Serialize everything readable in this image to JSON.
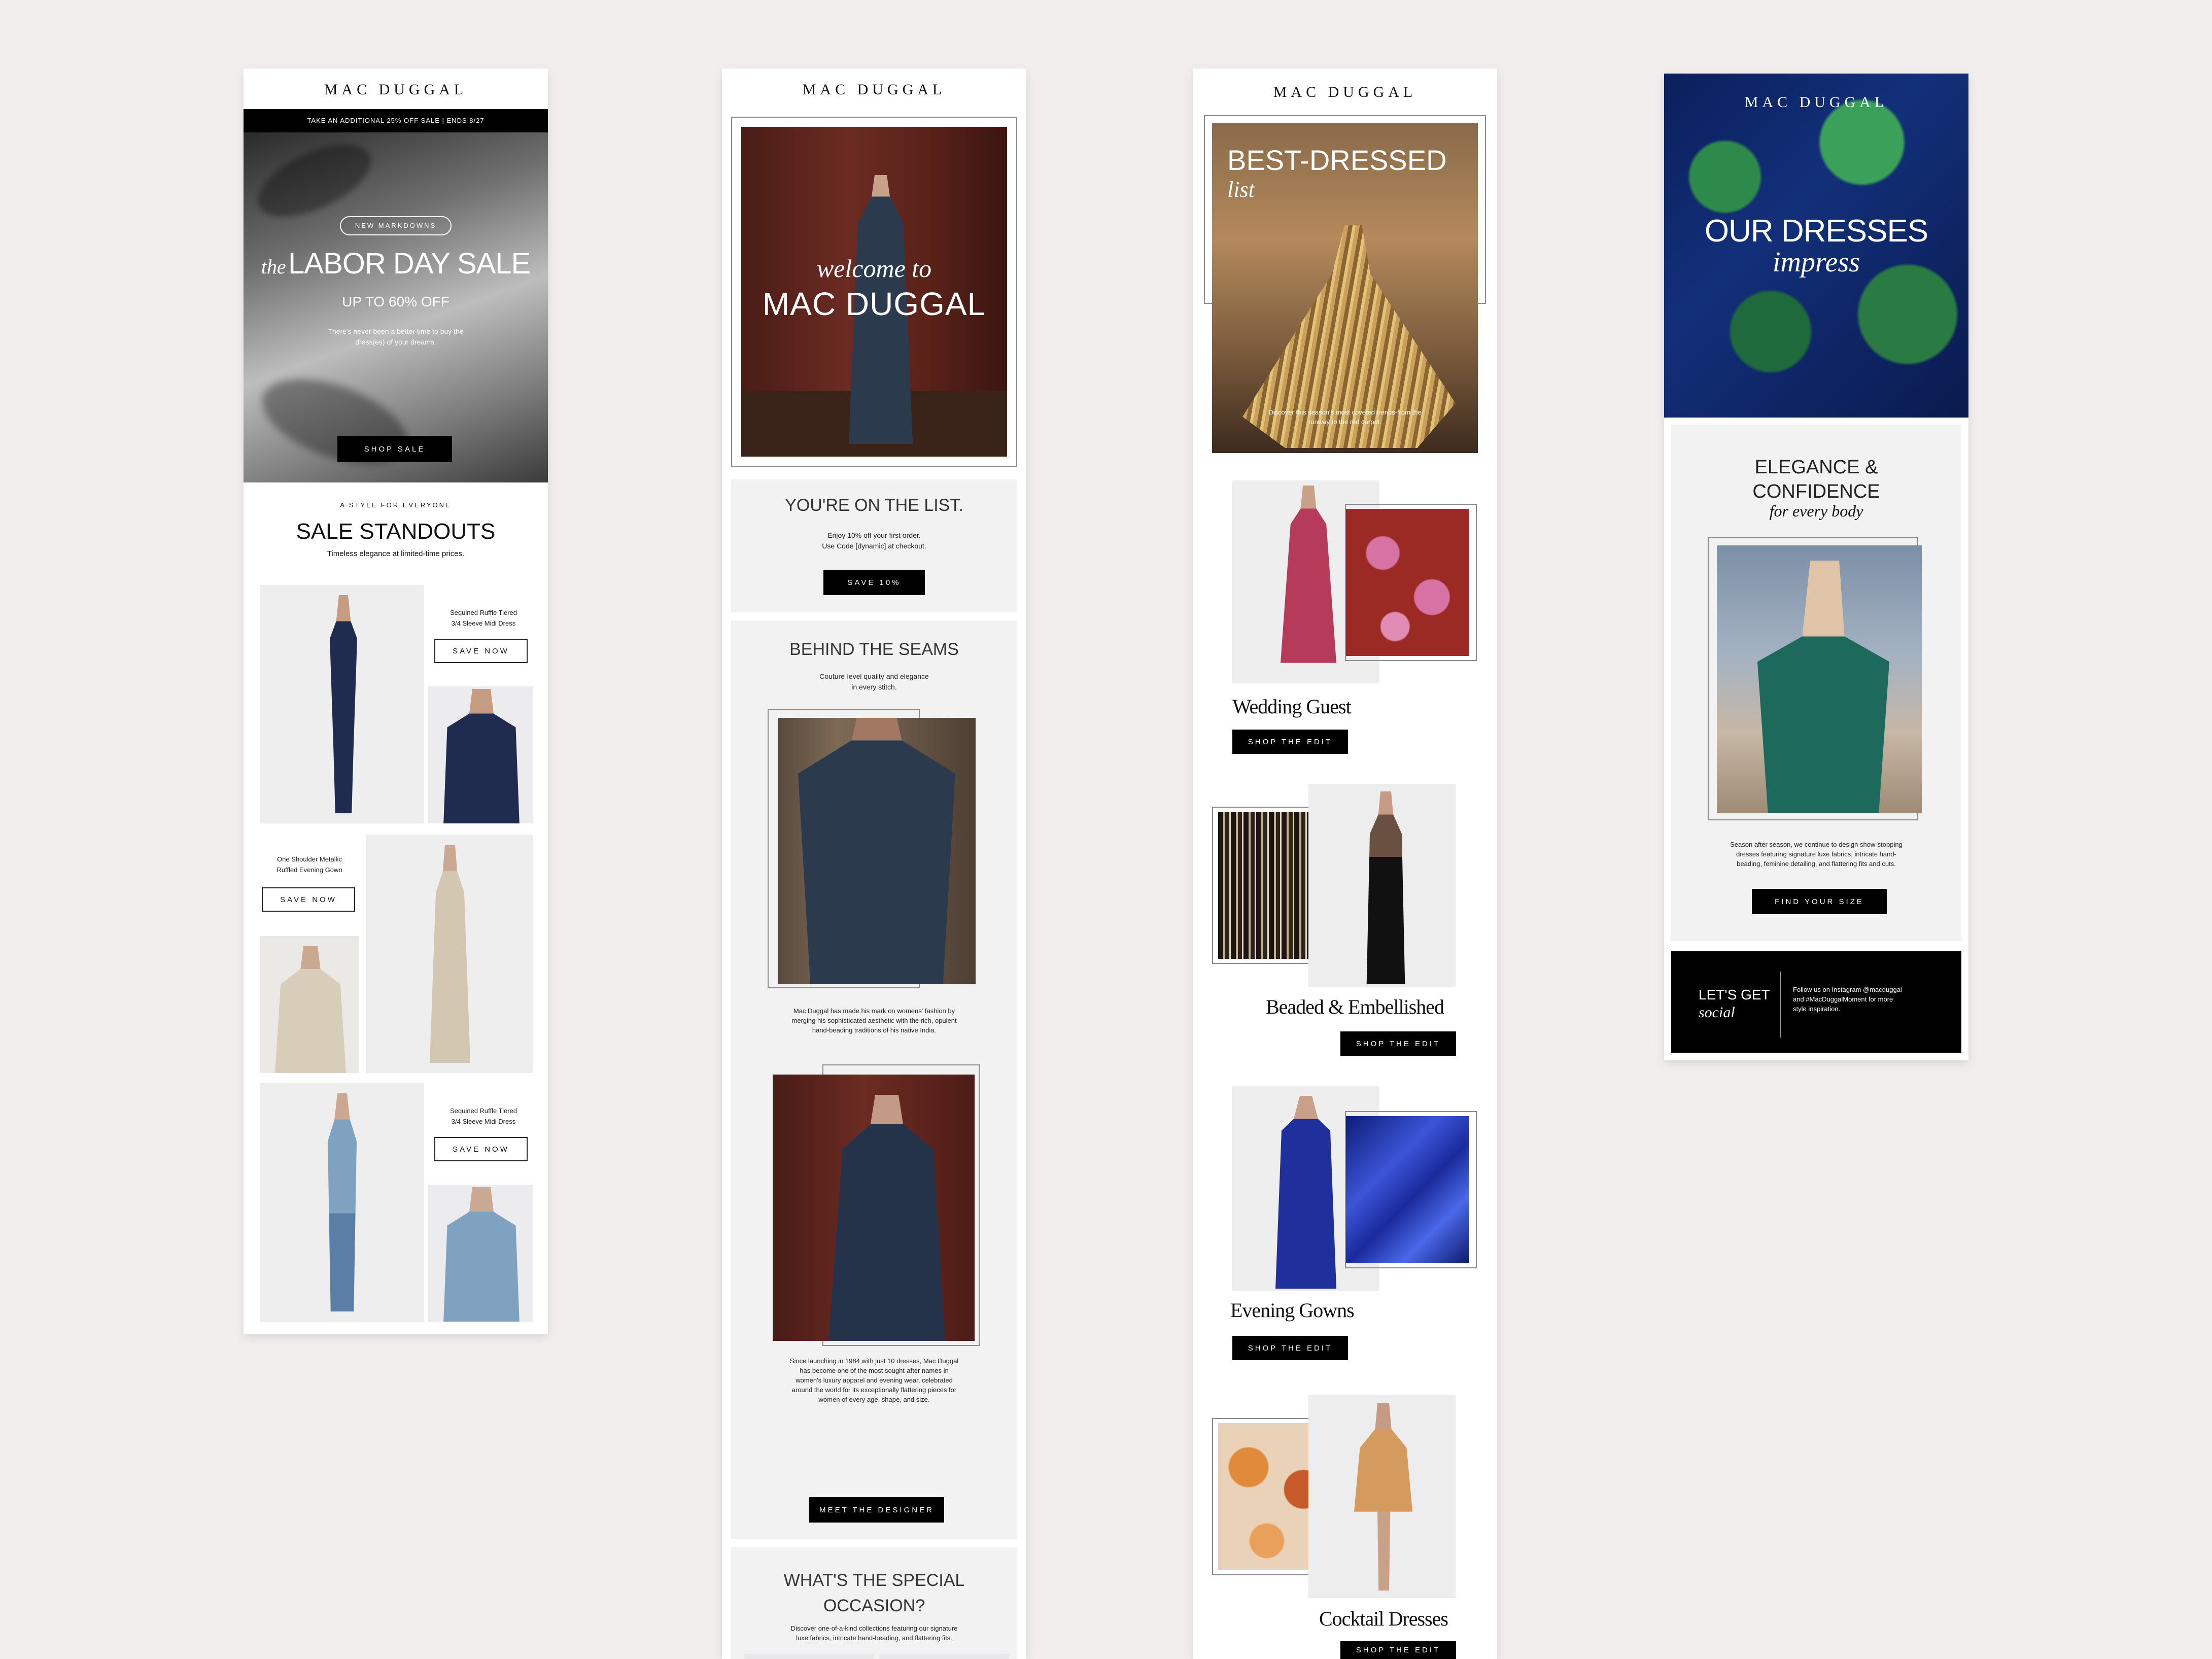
{
  "email1": {
    "brand": "MAC DUGGAL",
    "promo_bar": "TAKE AN ADDITIONAL 25% OFF SALE  |  ENDS 8/27",
    "hero_pill": "NEW MARKDOWNS",
    "hero_title_prefix": "the",
    "hero_title": "LABOR DAY SALE",
    "hero_subtitle": "UP TO 60% OFF",
    "hero_body_1": "There's never been a better time to buy the",
    "hero_body_2": "dress(es) of your dreams.",
    "hero_button": "SHOP SALE",
    "eyebrow": "A STYLE FOR EVERYONE",
    "section_title": "SALE STANDOUTS",
    "section_sub": "Timeless elegance at limited-time prices.",
    "products": [
      {
        "name_1": "Sequined Ruffle Tiered",
        "name_2": "3/4 Sleeve Midi Dress",
        "button": "SAVE NOW"
      },
      {
        "name_1": "One Shoulder Metallic",
        "name_2": "Ruffled Evening Gown",
        "button": "SAVE NOW"
      },
      {
        "name_1": "Sequined Ruffle Tiered",
        "name_2": "3/4 Sleeve Midi Dress",
        "button": "SAVE NOW"
      }
    ]
  },
  "email2": {
    "brand": "MAC DUGGAL",
    "hero_line_1": "welcome to",
    "hero_line_2": "MAC DUGGAL",
    "list_title": "YOU'RE ON THE LIST.",
    "list_body_1": "Enjoy 10% off your first order.",
    "list_body_2": "Use Code [dynamic] at checkout.",
    "list_button": "SAVE 10%",
    "seams_title": "BEHIND THE SEAMS",
    "seams_sub_1": "Couture-level quality and elegance",
    "seams_sub_2": "in every stitch.",
    "seams_body_1": "Mac Duggal has made his mark on womens' fashion by",
    "seams_body_2": "merging his sophisticated aesthetic with the rich, opulent",
    "seams_body_3": "hand-beading traditions of his native India.",
    "story_1": "Since launching in 1984 with just 10 dresses, Mac Duggal",
    "story_2": "has become one of the most sought-after names in",
    "story_3": "women's luxury apparel and evening wear, celebrated",
    "story_4": "around the world for its exceptionally flattering pieces for",
    "story_5": "women of every age, shape, and size.",
    "designer_button": "MEET THE DESIGNER",
    "occasion_title_1": "WHAT'S THE SPECIAL",
    "occasion_title_2": "OCCASION?",
    "occasion_body_1": "Discover one-of-a-kind collections featuring our signature",
    "occasion_body_2": "luxe fabrics, intricate hand-beading, and flattering fits."
  },
  "email3": {
    "brand": "MAC DUGGAL",
    "hero_title": "BEST-DRESSED",
    "hero_title_script": "list",
    "hero_body_1": "Discover this season's most coveted trends-from the",
    "hero_body_2": "runway to the red carpet.",
    "categories": [
      {
        "name": "Wedding Guest",
        "button": "SHOP THE EDIT"
      },
      {
        "name": "Beaded & Embellished",
        "button": "SHOP THE EDIT"
      },
      {
        "name": "Evening Gowns",
        "button": "SHOP THE EDIT"
      },
      {
        "name": "Cocktail Dresses",
        "button": "SHOP THE EDIT"
      }
    ]
  },
  "email4": {
    "brand": "MAC DUGGAL",
    "hero_line_1": "OUR DRESSES",
    "hero_line_2": "impress",
    "section_title_1": "ELEGANCE &",
    "section_title_2": "CONFIDENCE",
    "section_script": "for every body",
    "body_1": "Season after season, we continue to design show-stopping",
    "body_2": "dresses featuring signature luxe fabrics, intricate hand-",
    "body_3": "beading, feminine detailing, and flattering fits and cuts.",
    "button": "FIND YOUR SIZE",
    "social_title": "LET'S GET",
    "social_script": "social",
    "social_body_1": "Follow us on Instagram @macduggal",
    "social_body_2": "and #MacDuggalMoment for more",
    "social_body_3": "style inspiration."
  }
}
